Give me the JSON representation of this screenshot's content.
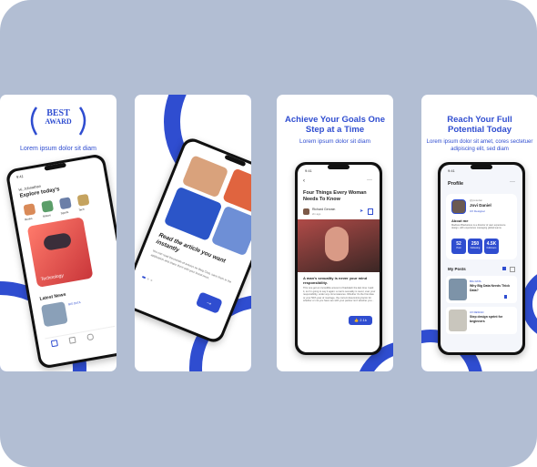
{
  "card1": {
    "badge_line1": "BEST",
    "badge_line2": "AWARD",
    "subtitle": "Lorem ipsum dolor sit diam",
    "status_time": "9:41",
    "greeting": "Hi, Johnathan",
    "heading": "Explore today's",
    "categories": [
      "Books",
      "Nature",
      "Sports",
      "Tech"
    ],
    "feature_label": "Technology",
    "section_title": "Latest News",
    "news_tag": "BIG DATA",
    "colors": {
      "accent": "#2f4dd0"
    }
  },
  "card2": {
    "article_title": "Read the article you want instantly",
    "article_body": "You can read thousands of articles on Blog Club, save them in the application and share them with your loved ones.",
    "next_icon": "arrow-right-icon"
  },
  "card3": {
    "headline": "Achieve Your Goals One Step at a Time",
    "subtitle": "Lorem ipsum dolor sit diam",
    "status_time": "9:41",
    "article_title": "Four Things Every Woman Needs To Know",
    "author_name": "Richard Gervain",
    "author_time": "2m ago",
    "quote": "A man's sexuality is never your mind responsibility.",
    "body": "This one got an incredible amount of backlash the last time I said it, so I'm going to say it again: a man's sexuality is never, ever your responsibility, under any circumstances. Whether it's the first date or your 50th year of marriage, the correct determining factor for whether or not you have sex with your partner isn't whether you…",
    "like_count": "2.1k"
  },
  "card4": {
    "headline": "Reach Your Full Potential Today",
    "subtitle": "Lorem ipsum dolor sit amet, cores sectetuer adipiscing elit, sed diam",
    "status_time": "9:41",
    "profile_title": "Profile",
    "handle": "@joviedan",
    "name": "Jovi Daniel",
    "role": "UX Designer",
    "about_title": "About me",
    "about_text": "Madison Blackstone is a director of user experience design, with experience managing global teams.",
    "stats": [
      {
        "value": "52",
        "label": "Post"
      },
      {
        "value": "250",
        "label": "Following"
      },
      {
        "value": "4.5K",
        "label": "Followers"
      }
    ],
    "posts_title": "My Posts",
    "posts": [
      {
        "tag": "BIG DATA",
        "title": "Why Big Data Needs Thick Data?"
      },
      {
        "tag": "UX DESIGN",
        "title": "Step design sprint for beginners"
      }
    ]
  }
}
